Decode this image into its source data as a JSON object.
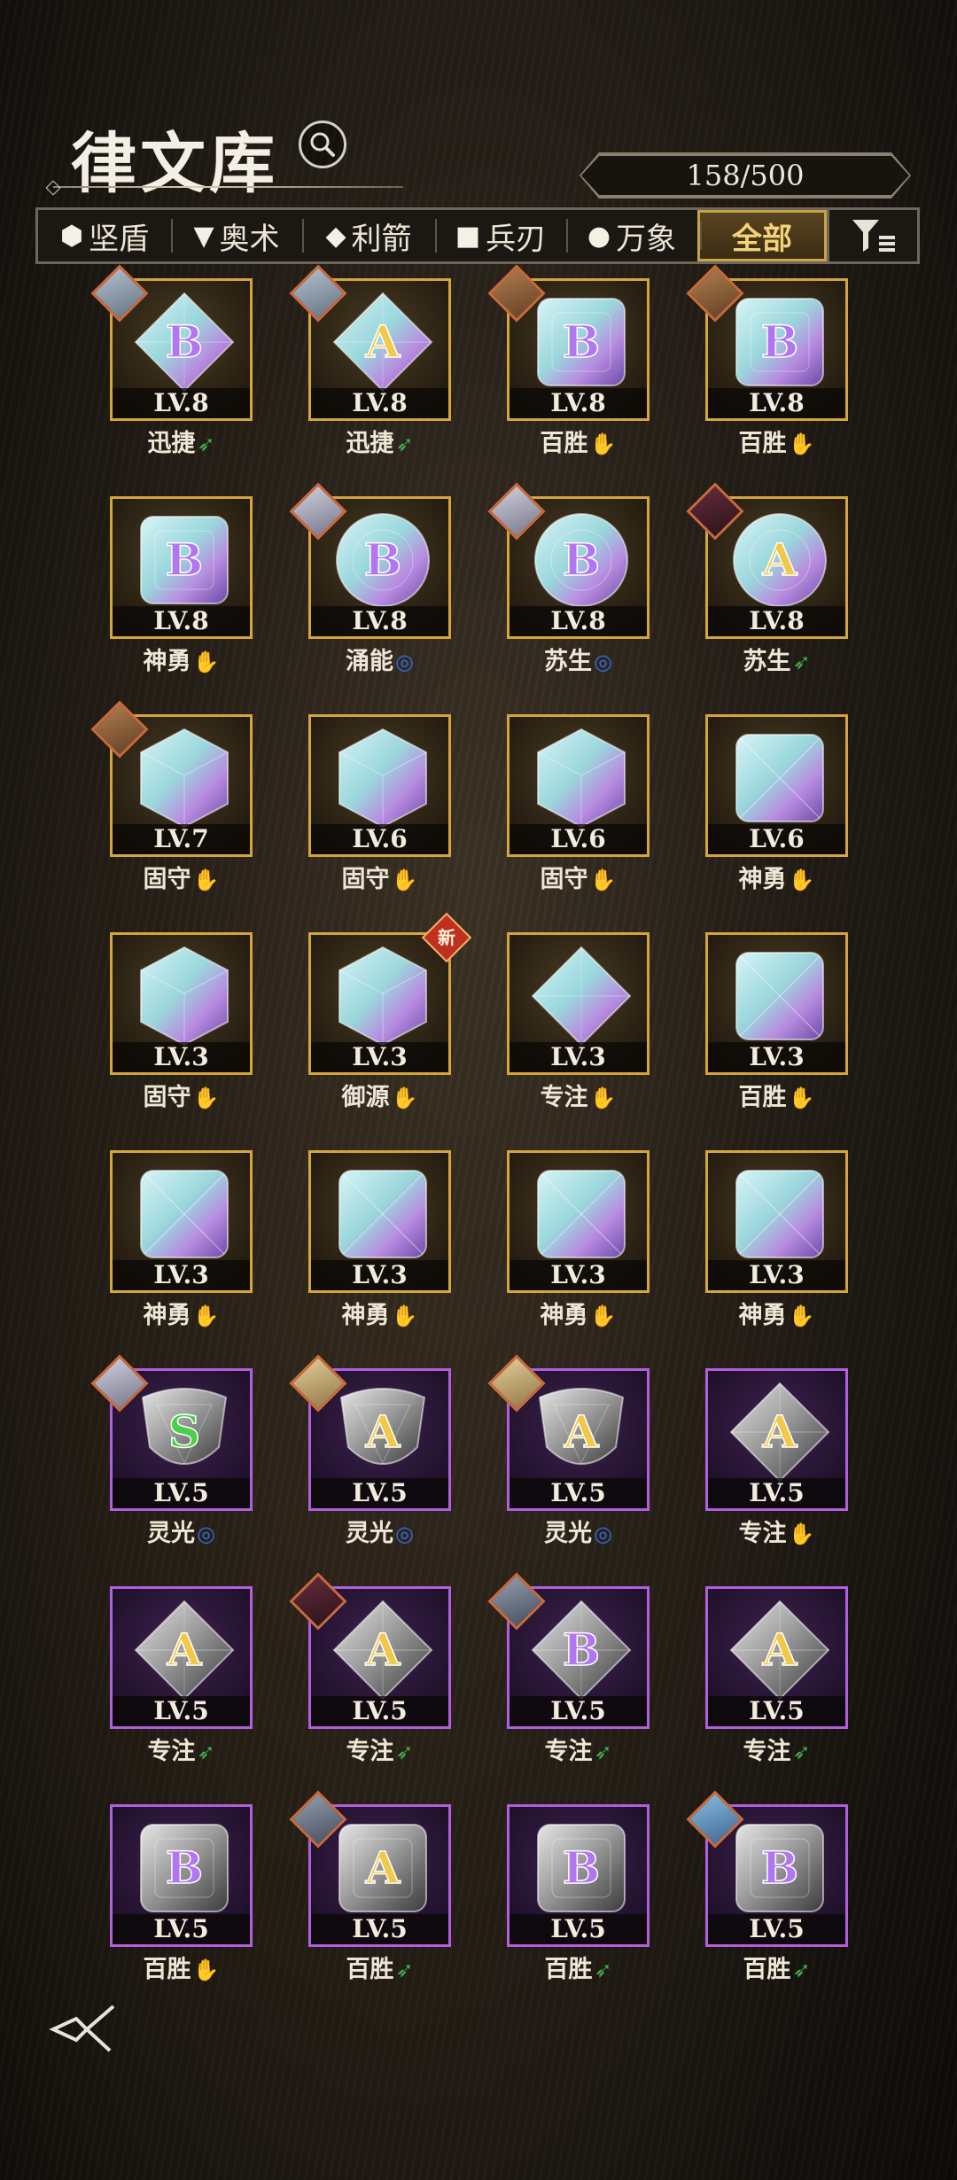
{
  "header": {
    "title": "律文库",
    "counter": "158/500"
  },
  "filters": [
    {
      "shape": "⬢",
      "label": "坚盾",
      "active": false
    },
    {
      "shape": "▼",
      "label": "奥术",
      "active": false
    },
    {
      "shape": "◆",
      "label": "利箭",
      "active": false
    },
    {
      "shape": "■",
      "label": "兵刃",
      "active": false
    },
    {
      "shape": "●",
      "label": "万象",
      "active": false
    },
    {
      "shape": "",
      "label": "全部",
      "active": true
    }
  ],
  "colors": {
    "gold_frame": "#d3a53c",
    "purple_frame": "#b060dd",
    "fire": "#d8302a",
    "wind": "#3fb14a",
    "water": "#2f6fe0"
  },
  "cards": [
    {
      "rarity": "gold",
      "gem": "diamond",
      "grade": "B",
      "level": "LV.8",
      "name": "迅捷",
      "element": "wind",
      "portrait": "silver-hair"
    },
    {
      "rarity": "gold",
      "gem": "diamond",
      "grade": "A",
      "level": "LV.8",
      "name": "迅捷",
      "element": "wind",
      "portrait": "silver-hair"
    },
    {
      "rarity": "gold",
      "gem": "square",
      "grade": "B",
      "level": "LV.8",
      "name": "百胜",
      "element": "fire",
      "portrait": "brown-hair"
    },
    {
      "rarity": "gold",
      "gem": "square",
      "grade": "B",
      "level": "LV.8",
      "name": "百胜",
      "element": "fire",
      "portrait": "brown-hair"
    },
    {
      "rarity": "gold",
      "gem": "square",
      "grade": "B",
      "level": "LV.8",
      "name": "神勇",
      "element": "fire",
      "portrait": ""
    },
    {
      "rarity": "gold",
      "gem": "round",
      "grade": "B",
      "level": "LV.8",
      "name": "涌能",
      "element": "water",
      "portrait": "white-beast"
    },
    {
      "rarity": "gold",
      "gem": "round",
      "grade": "B",
      "level": "LV.8",
      "name": "苏生",
      "element": "water",
      "portrait": "white-beast"
    },
    {
      "rarity": "gold",
      "gem": "round",
      "grade": "A",
      "level": "LV.8",
      "name": "苏生",
      "element": "wind",
      "portrait": "dark-hair"
    },
    {
      "rarity": "gold",
      "gem": "hexagon",
      "grade": "",
      "level": "LV.7",
      "name": "固守",
      "element": "fire",
      "portrait": "brown-hair"
    },
    {
      "rarity": "gold",
      "gem": "hexagon",
      "grade": "",
      "level": "LV.6",
      "name": "固守",
      "element": "fire",
      "portrait": ""
    },
    {
      "rarity": "gold",
      "gem": "hexagon",
      "grade": "",
      "level": "LV.6",
      "name": "固守",
      "element": "fire",
      "portrait": ""
    },
    {
      "rarity": "gold",
      "gem": "square-x",
      "grade": "",
      "level": "LV.6",
      "name": "神勇",
      "element": "fire",
      "portrait": ""
    },
    {
      "rarity": "gold",
      "gem": "hexagon",
      "grade": "",
      "level": "LV.3",
      "name": "固守",
      "element": "fire",
      "portrait": ""
    },
    {
      "rarity": "gold",
      "gem": "hexagon",
      "grade": "",
      "level": "LV.3",
      "name": "御源",
      "element": "fire",
      "portrait": "",
      "new": "新"
    },
    {
      "rarity": "gold",
      "gem": "diamond",
      "grade": "",
      "level": "LV.3",
      "name": "专注",
      "element": "fire",
      "portrait": ""
    },
    {
      "rarity": "gold",
      "gem": "square-x",
      "grade": "",
      "level": "LV.3",
      "name": "百胜",
      "element": "fire",
      "portrait": ""
    },
    {
      "rarity": "gold",
      "gem": "square-x",
      "grade": "",
      "level": "LV.3",
      "name": "神勇",
      "element": "fire",
      "portrait": ""
    },
    {
      "rarity": "gold",
      "gem": "square-x",
      "grade": "",
      "level": "LV.3",
      "name": "神勇",
      "element": "fire",
      "portrait": ""
    },
    {
      "rarity": "gold",
      "gem": "square-x",
      "grade": "",
      "level": "LV.3",
      "name": "神勇",
      "element": "fire",
      "portrait": ""
    },
    {
      "rarity": "gold",
      "gem": "square-x",
      "grade": "",
      "level": "LV.3",
      "name": "神勇",
      "element": "fire",
      "portrait": ""
    },
    {
      "rarity": "purple",
      "gem": "shield",
      "grade": "S",
      "level": "LV.5",
      "name": "灵光",
      "element": "water",
      "portrait": "white-beast"
    },
    {
      "rarity": "purple",
      "gem": "shield",
      "grade": "A",
      "level": "LV.5",
      "name": "灵光",
      "element": "water",
      "portrait": "blonde"
    },
    {
      "rarity": "purple",
      "gem": "shield",
      "grade": "A",
      "level": "LV.5",
      "name": "灵光",
      "element": "water",
      "portrait": "blonde"
    },
    {
      "rarity": "purple",
      "gem": "stone-diamond",
      "grade": "A",
      "level": "LV.5",
      "name": "专注",
      "element": "fire",
      "portrait": ""
    },
    {
      "rarity": "purple",
      "gem": "stone-diamond",
      "grade": "A",
      "level": "LV.5",
      "name": "专注",
      "element": "wind",
      "portrait": ""
    },
    {
      "rarity": "purple",
      "gem": "stone-diamond",
      "grade": "A",
      "level": "LV.5",
      "name": "专注",
      "element": "wind",
      "portrait": "dark-hair"
    },
    {
      "rarity": "purple",
      "gem": "stone-diamond",
      "grade": "B",
      "level": "LV.5",
      "name": "专注",
      "element": "wind",
      "portrait": "mech"
    },
    {
      "rarity": "purple",
      "gem": "stone-diamond",
      "grade": "A",
      "level": "LV.5",
      "name": "专注",
      "element": "wind",
      "portrait": ""
    },
    {
      "rarity": "purple",
      "gem": "stone-square",
      "grade": "B",
      "level": "LV.5",
      "name": "百胜",
      "element": "fire",
      "portrait": ""
    },
    {
      "rarity": "purple",
      "gem": "stone-square",
      "grade": "A",
      "level": "LV.5",
      "name": "百胜",
      "element": "wind",
      "portrait": "mech"
    },
    {
      "rarity": "purple",
      "gem": "stone-square",
      "grade": "B",
      "level": "LV.5",
      "name": "百胜",
      "element": "wind",
      "portrait": ""
    },
    {
      "rarity": "purple",
      "gem": "stone-square",
      "grade": "B",
      "level": "LV.5",
      "name": "百胜",
      "element": "wind",
      "portrait": "blue-hair"
    }
  ]
}
